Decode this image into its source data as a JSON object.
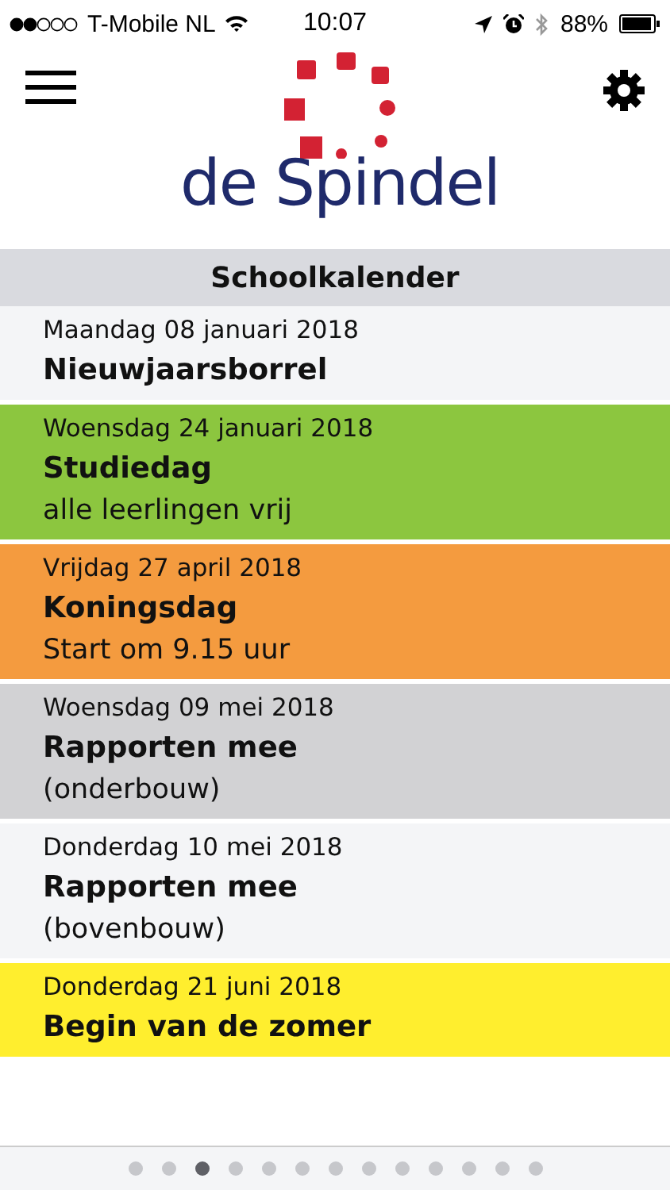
{
  "status_bar": {
    "carrier": "T-Mobile NL",
    "time": "10:07",
    "battery": "88%"
  },
  "header": {
    "logo_text": "de Spindel"
  },
  "section": {
    "title": "Schoolkalender"
  },
  "events": [
    {
      "date": "Maandag 08 januari 2018",
      "title": "Nieuwjaarsborrel",
      "color": "#f4f5f7"
    },
    {
      "date": "Woensdag 24 januari 2018",
      "title": "Studiedag",
      "note": "alle leerlingen vrij",
      "color": "#8cc63f"
    },
    {
      "date": "Vrijdag 27 april 2018",
      "title": "Koningsdag",
      "note": "Start om 9.15 uur",
      "color": "#f49b3f"
    },
    {
      "date": "Woensdag 09 mei 2018",
      "title": "Rapporten mee",
      "note": "(onderbouw)",
      "color": "#d2d2d4"
    },
    {
      "date": "Donderdag 10 mei 2018",
      "title": "Rapporten mee",
      "note": "(bovenbouw)",
      "color": "#f4f5f7"
    },
    {
      "date": "Donderdag 21 juni 2018",
      "title": "Begin van de zomer",
      "color": "#ffee2e"
    }
  ],
  "pages": [
    {
      "selected": false
    },
    {
      "selected": false
    },
    {
      "selected": true
    },
    {
      "selected": false
    },
    {
      "selected": false
    },
    {
      "selected": false
    },
    {
      "selected": false
    },
    {
      "selected": false
    },
    {
      "selected": false
    },
    {
      "selected": false
    },
    {
      "selected": false
    },
    {
      "selected": false
    },
    {
      "selected": false
    }
  ]
}
